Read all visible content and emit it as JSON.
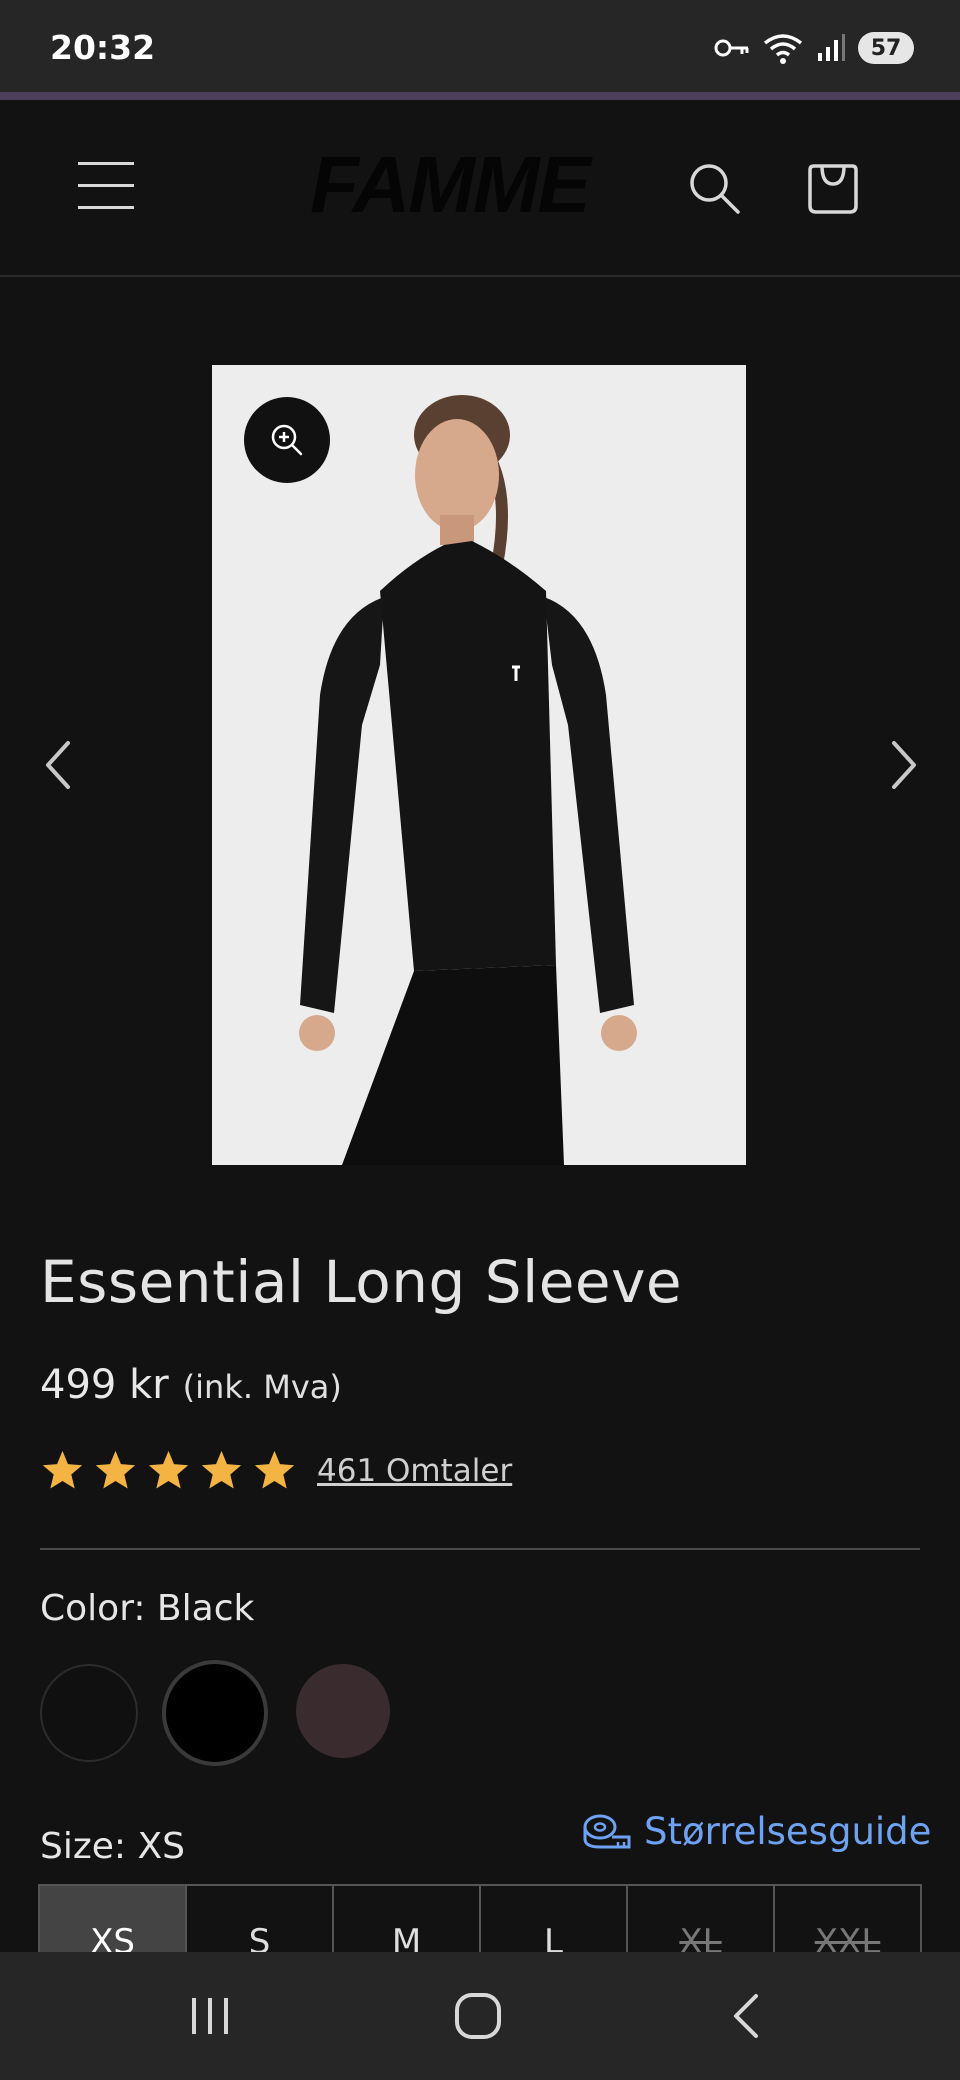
{
  "status_bar": {
    "time": "20:32",
    "battery": "57"
  },
  "header": {
    "logo": "FAMME"
  },
  "product": {
    "title": "Essential Long Sleeve",
    "price": "499 kr",
    "price_note": "(ink. Mva)",
    "rating": 5,
    "reviews_label": "461 Omtaler",
    "color_label": "Color: Black",
    "swatches": [
      {
        "name": "Black",
        "color": "#101010",
        "selected": false
      },
      {
        "name": "Black",
        "color": "#000000",
        "selected": true
      },
      {
        "name": "Brown",
        "color": "#3a2c2e",
        "selected": false
      }
    ],
    "size_label": "Size: XS",
    "size_guide": "Størrelsesguide",
    "sizes": [
      {
        "label": "XS",
        "selected": true,
        "available": true
      },
      {
        "label": "S",
        "selected": false,
        "available": true
      },
      {
        "label": "M",
        "selected": false,
        "available": true
      },
      {
        "label": "L",
        "selected": false,
        "available": true
      },
      {
        "label": "XL",
        "selected": false,
        "available": false
      },
      {
        "label": "XXL",
        "selected": false,
        "available": false
      }
    ]
  },
  "colors": {
    "accent_link": "#6ea2f2",
    "star": "#f4b443",
    "background": "#121212"
  }
}
